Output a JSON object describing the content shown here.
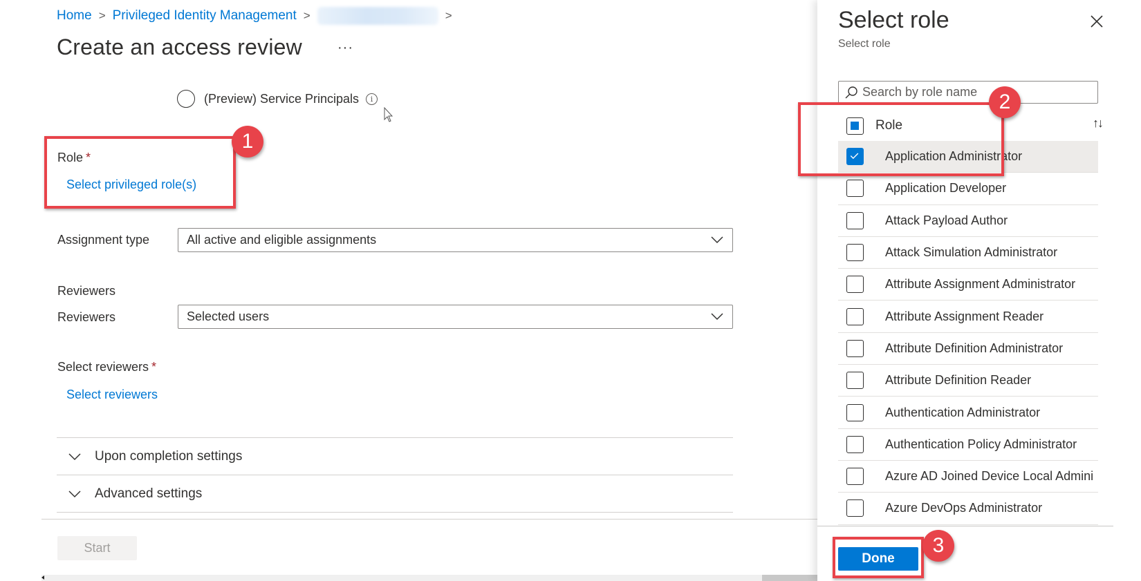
{
  "breadcrumb": {
    "items": [
      "Home",
      "Privileged Identity Management"
    ],
    "separator": ">"
  },
  "page": {
    "title": "Create an access review",
    "more_label": "···"
  },
  "scope": {
    "service_principals_label": "(Preview) Service Principals",
    "info_glyph": "i"
  },
  "form": {
    "role_label": "Role",
    "required_mark": "*",
    "select_role_link": "Select privileged role(s)",
    "assignment_type_label": "Assignment type",
    "assignment_type_value": "All active and eligible assignments",
    "reviewers_section_label": "Reviewers",
    "reviewers_label": "Reviewers",
    "reviewers_value": "Selected users",
    "select_reviewers_label": "Select reviewers",
    "select_reviewers_link": "Select reviewers"
  },
  "sections": [
    {
      "label": "Upon completion settings"
    },
    {
      "label": "Advanced settings"
    }
  ],
  "footer": {
    "start_label": "Start"
  },
  "panel": {
    "title": "Select role",
    "subtitle": "Select role",
    "search_placeholder": "Search by role name",
    "column_header": "Role",
    "sort_glyph": "↑↓",
    "roles": [
      {
        "name": "Application Administrator",
        "checked": true
      },
      {
        "name": "Application Developer",
        "checked": false
      },
      {
        "name": "Attack Payload Author",
        "checked": false
      },
      {
        "name": "Attack Simulation Administrator",
        "checked": false
      },
      {
        "name": "Attribute Assignment Administrator",
        "checked": false
      },
      {
        "name": "Attribute Assignment Reader",
        "checked": false
      },
      {
        "name": "Attribute Definition Administrator",
        "checked": false
      },
      {
        "name": "Attribute Definition Reader",
        "checked": false
      },
      {
        "name": "Authentication Administrator",
        "checked": false
      },
      {
        "name": "Authentication Policy Administrator",
        "checked": false
      },
      {
        "name": "Azure AD Joined Device Local Admini",
        "checked": false
      },
      {
        "name": "Azure DevOps Administrator",
        "checked": false
      }
    ],
    "done_label": "Done"
  },
  "annotations": {
    "step1": "1",
    "step2": "2",
    "step3": "3",
    "color": "#e8434a"
  },
  "colors": {
    "accent": "#0078d4",
    "required": "#a4262c",
    "text": "#323130"
  }
}
